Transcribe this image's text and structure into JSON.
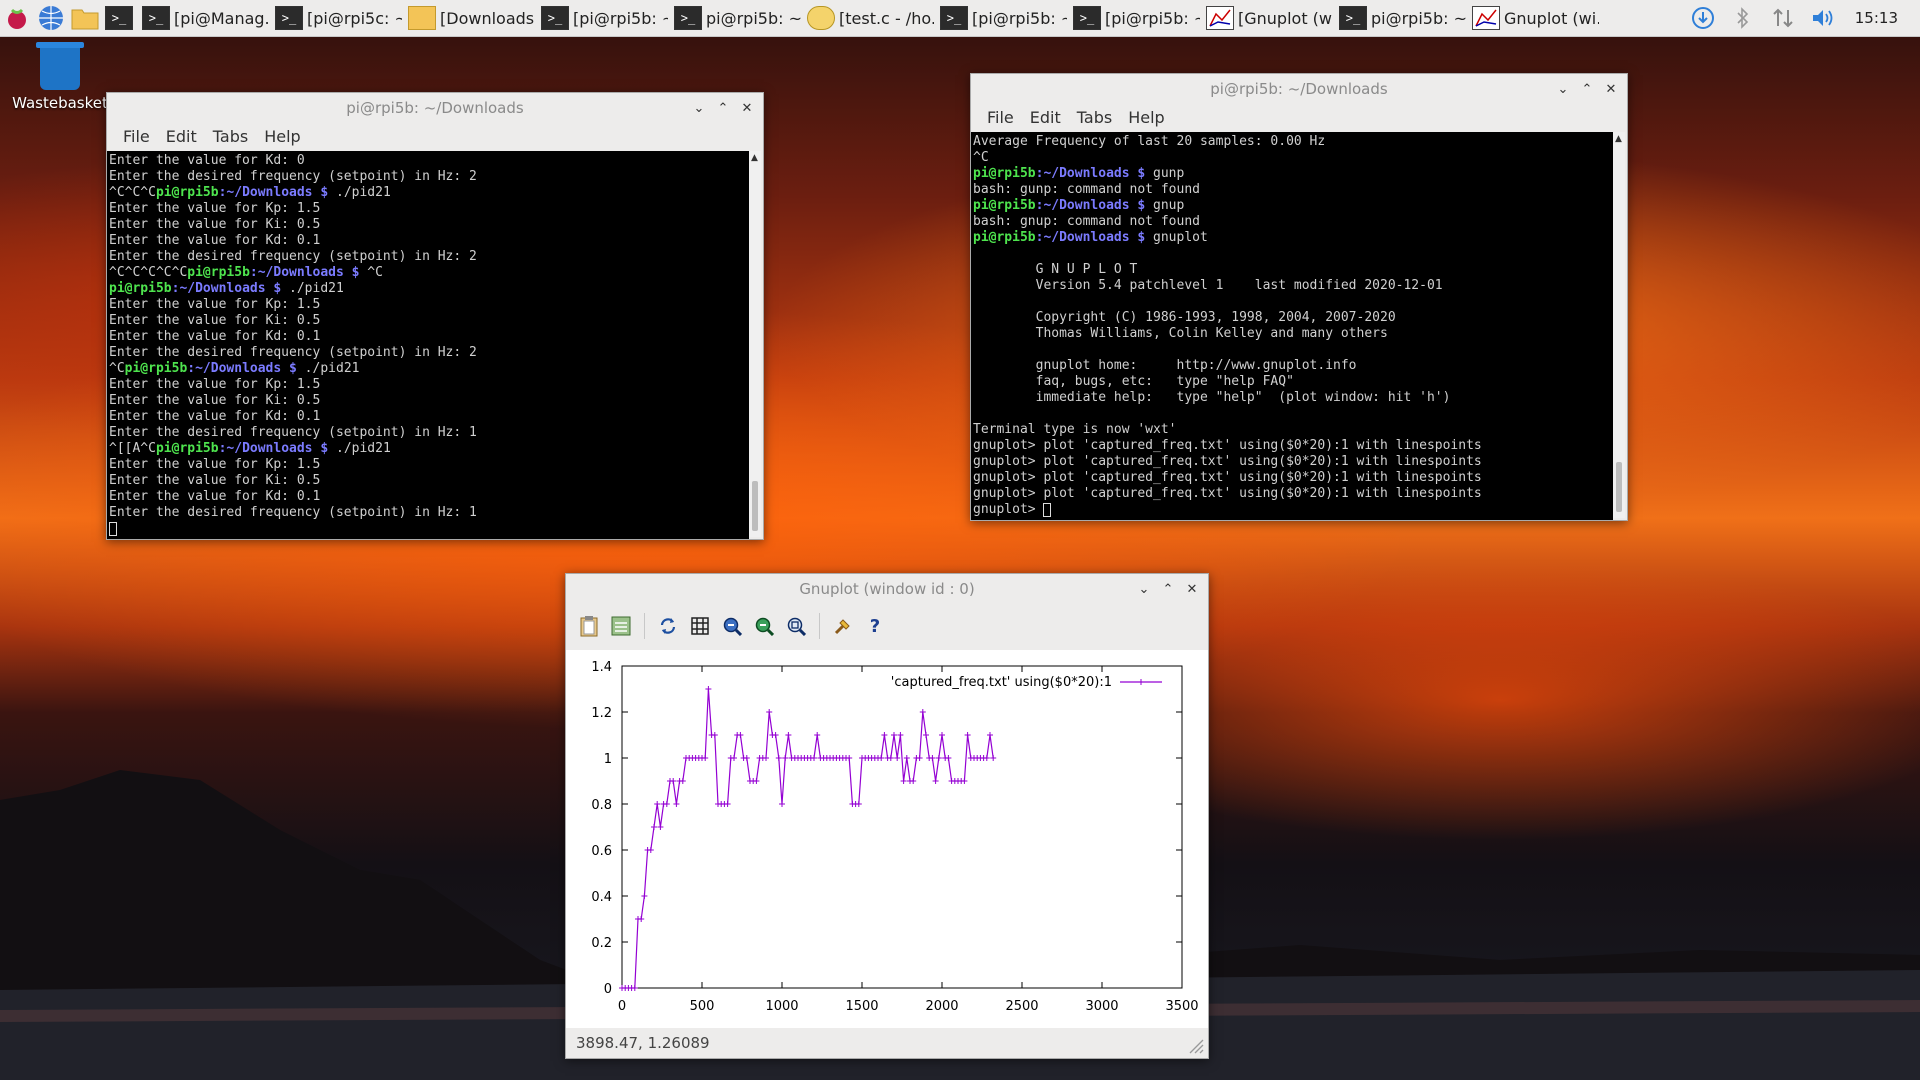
{
  "taskbar": {
    "items": [
      {
        "label": "[pi@Manag...",
        "icon": "terminal-icon"
      },
      {
        "label": "[pi@rpi5c: ~]",
        "icon": "terminal-icon"
      },
      {
        "label": "[Downloads]",
        "icon": "folder-icon"
      },
      {
        "label": "[pi@rpi5b: ~]",
        "icon": "terminal-icon"
      },
      {
        "label": "pi@rpi5b: ~...",
        "icon": "terminal-icon"
      },
      {
        "label": "[test.c - /ho...",
        "icon": "editor-icon"
      },
      {
        "label": "[pi@rpi5b: ~...",
        "icon": "terminal-icon"
      },
      {
        "label": "[pi@rpi5b: ~...",
        "icon": "terminal-icon"
      },
      {
        "label": "[Gnuplot (wi...",
        "icon": "gnuplot-icon"
      },
      {
        "label": "pi@rpi5b: ~...",
        "icon": "terminal-icon"
      },
      {
        "label": "Gnuplot (wi...",
        "icon": "gnuplot-icon"
      }
    ],
    "clock": "15:13"
  },
  "desktop": {
    "wastebasket_label": "Wastebasket"
  },
  "terminal_left": {
    "title": "pi@rpi5b: ~/Downloads",
    "menu": [
      "File",
      "Edit",
      "Tabs",
      "Help"
    ],
    "lines": [
      {
        "text": "Enter the value for Kd: 0"
      },
      {
        "text": "Enter the desired frequency (setpoint) in Hz: 2"
      },
      {
        "pre": "^C^C^C",
        "user": "pi@rpi5b",
        "path": ":~/Downloads $",
        "cmd": " ./pid21"
      },
      {
        "text": "Enter the value for Kp: 1.5"
      },
      {
        "text": "Enter the value for Ki: 0.5"
      },
      {
        "text": "Enter the value for Kd: 0.1"
      },
      {
        "text": "Enter the desired frequency (setpoint) in Hz: 2"
      },
      {
        "pre": "^C^C^C^C^C",
        "user": "pi@rpi5b",
        "path": ":~/Downloads $",
        "cmd": " ^C"
      },
      {
        "pre": "",
        "user": "pi@rpi5b",
        "path": ":~/Downloads $",
        "cmd": " ./pid21"
      },
      {
        "text": "Enter the value for Kp: 1.5"
      },
      {
        "text": "Enter the value for Ki: 0.5"
      },
      {
        "text": "Enter the value for Kd: 0.1"
      },
      {
        "text": "Enter the desired frequency (setpoint) in Hz: 2"
      },
      {
        "pre": "^C",
        "user": "pi@rpi5b",
        "path": ":~/Downloads $",
        "cmd": " ./pid21"
      },
      {
        "text": "Enter the value for Kp: 1.5"
      },
      {
        "text": "Enter the value for Ki: 0.5"
      },
      {
        "text": "Enter the value for Kd: 0.1"
      },
      {
        "text": "Enter the desired frequency (setpoint) in Hz: 1"
      },
      {
        "pre": "^[[A^C",
        "user": "pi@rpi5b",
        "path": ":~/Downloads $",
        "cmd": " ./pid21"
      },
      {
        "text": "Enter the value for Kp: 1.5"
      },
      {
        "text": "Enter the value for Ki: 0.5"
      },
      {
        "text": "Enter the value for Kd: 0.1"
      },
      {
        "text": "Enter the desired frequency (setpoint) in Hz: 1"
      },
      {
        "cursor": true
      }
    ]
  },
  "terminal_right": {
    "title": "pi@rpi5b: ~/Downloads",
    "menu": [
      "File",
      "Edit",
      "Tabs",
      "Help"
    ],
    "lines": [
      {
        "text": "Average Frequency of last 20 samples: 0.00 Hz"
      },
      {
        "text": "^C"
      },
      {
        "pre": "",
        "user": "pi@rpi5b",
        "path": ":~/Downloads $",
        "cmd": " gunp"
      },
      {
        "text": "bash: gunp: command not found"
      },
      {
        "pre": "",
        "user": "pi@rpi5b",
        "path": ":~/Downloads $",
        "cmd": " gnup"
      },
      {
        "text": "bash: gnup: command not found"
      },
      {
        "pre": "",
        "user": "pi@rpi5b",
        "path": ":~/Downloads $",
        "cmd": " gnuplot"
      },
      {
        "text": ""
      },
      {
        "text": "        G N U P L O T"
      },
      {
        "text": "        Version 5.4 patchlevel 1    last modified 2020-12-01"
      },
      {
        "text": ""
      },
      {
        "text": "        Copyright (C) 1986-1993, 1998, 2004, 2007-2020"
      },
      {
        "text": "        Thomas Williams, Colin Kelley and many others"
      },
      {
        "text": ""
      },
      {
        "text": "        gnuplot home:     http://www.gnuplot.info"
      },
      {
        "text": "        faq, bugs, etc:   type \"help FAQ\""
      },
      {
        "text": "        immediate help:   type \"help\"  (plot window: hit 'h')"
      },
      {
        "text": ""
      },
      {
        "text": "Terminal type is now 'wxt'"
      },
      {
        "text": "gnuplot> plot 'captured_freq.txt' using($0*20):1 with linespoints"
      },
      {
        "text": "gnuplot> plot 'captured_freq.txt' using($0*20):1 with linespoints"
      },
      {
        "text": "gnuplot> plot 'captured_freq.txt' using($0*20):1 with linespoints"
      },
      {
        "text": "gnuplot> plot 'captured_freq.txt' using($0*20):1 with linespoints"
      },
      {
        "text": "gnuplot> ",
        "cursor": true
      }
    ]
  },
  "gnuplot_window": {
    "title": "Gnuplot (window id : 0)",
    "toolbar": [
      "clipboard-icon",
      "export-icon",
      "replot-icon",
      "grid-icon",
      "zoom-prev-icon",
      "zoom-next-icon",
      "autoscale-icon",
      "config-icon",
      "help-icon"
    ],
    "status": "3898.47,  1.26089"
  },
  "chart_data": {
    "type": "line",
    "xlim": [
      0,
      3500
    ],
    "ylim": [
      0,
      1.4
    ],
    "x_ticks": [
      "0",
      "500",
      "1000",
      "1500",
      "2000",
      "2500",
      "3000",
      "3500"
    ],
    "y_ticks": [
      "0",
      "0.2",
      "0.4",
      "0.6",
      "0.8",
      "1",
      "1.2",
      "1.4"
    ],
    "legend_position": "top-right",
    "color": "#9400d3",
    "series": [
      {
        "name": "'captured_freq.txt' using($0*20):1",
        "values": [
          0,
          0,
          0,
          0,
          0,
          0.3,
          0.3,
          0.4,
          0.6,
          0.6,
          0.7,
          0.8,
          0.7,
          0.8,
          0.8,
          0.9,
          0.9,
          0.8,
          0.9,
          0.9,
          1,
          1,
          1,
          1,
          1,
          1,
          1,
          1.3,
          1.1,
          1.1,
          0.8,
          0.8,
          0.8,
          0.8,
          1,
          1,
          1.1,
          1.1,
          1,
          1,
          0.9,
          0.9,
          0.9,
          1,
          1,
          1,
          1.2,
          1.1,
          1.1,
          1,
          0.8,
          1,
          1.1,
          1,
          1,
          1,
          1,
          1,
          1,
          1,
          1,
          1.1,
          1,
          1,
          1,
          1,
          1,
          1,
          1,
          1,
          1,
          1,
          0.8,
          0.8,
          0.8,
          1,
          1,
          1,
          1,
          1,
          1,
          1,
          1.1,
          1,
          1,
          1.1,
          1,
          1.1,
          0.9,
          1,
          0.9,
          0.9,
          1,
          1,
          1.2,
          1.1,
          1,
          1,
          0.9,
          1,
          1.1,
          1,
          1,
          0.9,
          0.9,
          0.9,
          0.9,
          0.9,
          1.1,
          1,
          1,
          1,
          1,
          1,
          1,
          1.1,
          1
        ]
      }
    ]
  }
}
